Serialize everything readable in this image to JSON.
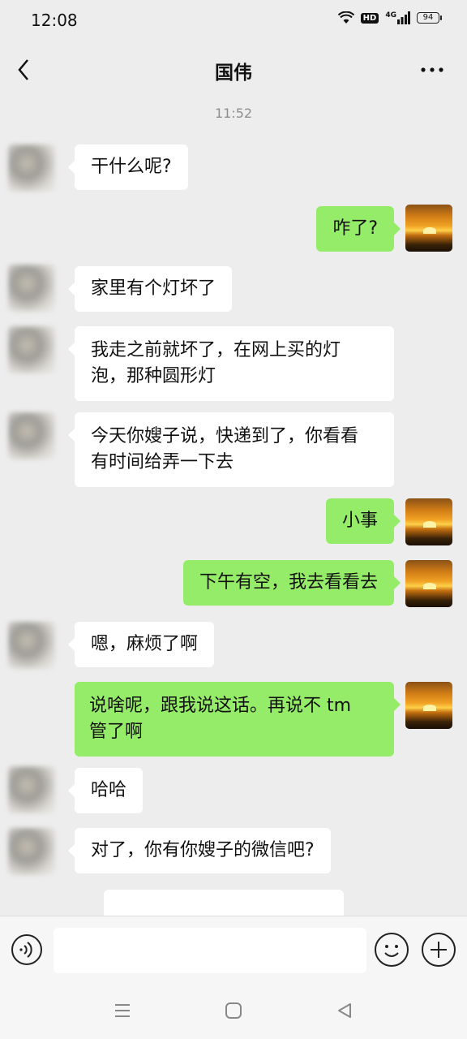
{
  "status_bar": {
    "time": "12:08",
    "network": "4G",
    "hd": "HD",
    "battery": "94"
  },
  "nav": {
    "title": "国伟"
  },
  "timestamp": "11:52",
  "messages": [
    {
      "side": "left",
      "text": "干什么呢?"
    },
    {
      "side": "right",
      "text": "咋了?"
    },
    {
      "side": "left",
      "text": "家里有个灯坏了"
    },
    {
      "side": "left",
      "lines": [
        "我走之前就坏了，在网上买的灯",
        "泡，那种圆形灯"
      ]
    },
    {
      "side": "left",
      "lines": [
        "今天你嫂子说，快递到了，你看看",
        "有时间给弄一下去"
      ]
    },
    {
      "side": "right",
      "text": "小事"
    },
    {
      "side": "right",
      "text": "下午有空，我去看看去"
    },
    {
      "side": "left",
      "text": "嗯，麻烦了啊"
    },
    {
      "side": "right",
      "lines": [
        "说啥呢，跟我说这话。再说不 tm",
        "管了啊"
      ]
    },
    {
      "side": "left",
      "text": "哈哈"
    },
    {
      "side": "left",
      "text": "对了，你有你嫂子的微信吧?"
    }
  ],
  "colors": {
    "background": "#ededed",
    "bubble_self": "#95ec69",
    "bubble_other": "#ffffff"
  },
  "icons": [
    "back-icon",
    "more-icon",
    "voice-icon",
    "emoji-icon",
    "add-icon",
    "wifi-icon",
    "signal-icon",
    "battery-icon"
  ]
}
